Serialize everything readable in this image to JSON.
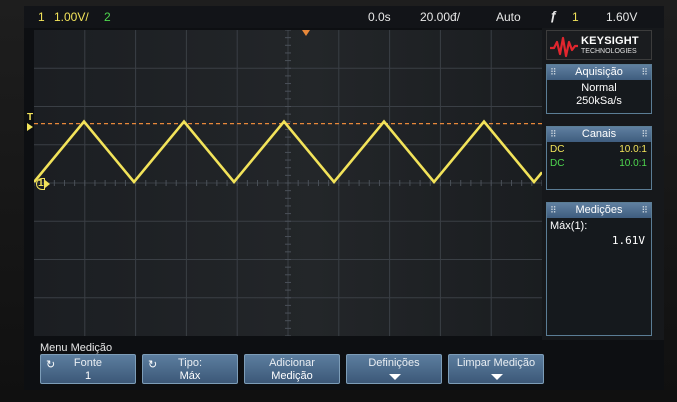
{
  "status_bar": {
    "ch1_number": "1",
    "ch1_scale": "1.00V/",
    "ch2_number": "2",
    "time_offset": "0.0s",
    "time_scale": "20.00đ/",
    "trigger_mode": "Auto",
    "trigger_slope_icon": "rising-edge-icon",
    "trigger_source": "1",
    "trigger_level": "1.60V"
  },
  "brand": {
    "name": "KEYSIGHT",
    "subtitle": "TECHNOLOGIES"
  },
  "acquisition": {
    "title": "Aquisição",
    "mode": "Normal",
    "rate": "250kSa/s"
  },
  "channels": {
    "title": "Canais",
    "rows": [
      {
        "coupling": "DC",
        "probe": "10.0:1",
        "color": "#f2e35a"
      },
      {
        "coupling": "DC",
        "probe": "10.0:1",
        "color": "#4fd84f"
      }
    ]
  },
  "measurements": {
    "title": "Medições",
    "label": "Máx(1):",
    "value": "1.61V"
  },
  "markers": {
    "trigger_level_marker": "T",
    "ch1_ground_marker": "1"
  },
  "menu": {
    "title": "Menu Medição",
    "softkeys": [
      {
        "line1": "Fonte",
        "line2": "1"
      },
      {
        "line1": "Tipo:",
        "line2": "Máx"
      },
      {
        "line1": "Adicionar",
        "line2": "Medição"
      },
      {
        "line1": "Definições",
        "line2": ""
      },
      {
        "line1": "Limpar Medição",
        "line2": ""
      }
    ]
  },
  "waveform": {
    "shape": "triangle",
    "channel": "1",
    "color": "#f2e35a",
    "peak_volts": 1.61,
    "trough_volts": 0,
    "period_divisions": 2,
    "volts_per_division": 1.0
  },
  "colors": {
    "ch1": "#f2e35a",
    "ch2": "#4fd84f",
    "trigger_line": "#e8883a",
    "accent_blue": "#5f7fa0"
  }
}
